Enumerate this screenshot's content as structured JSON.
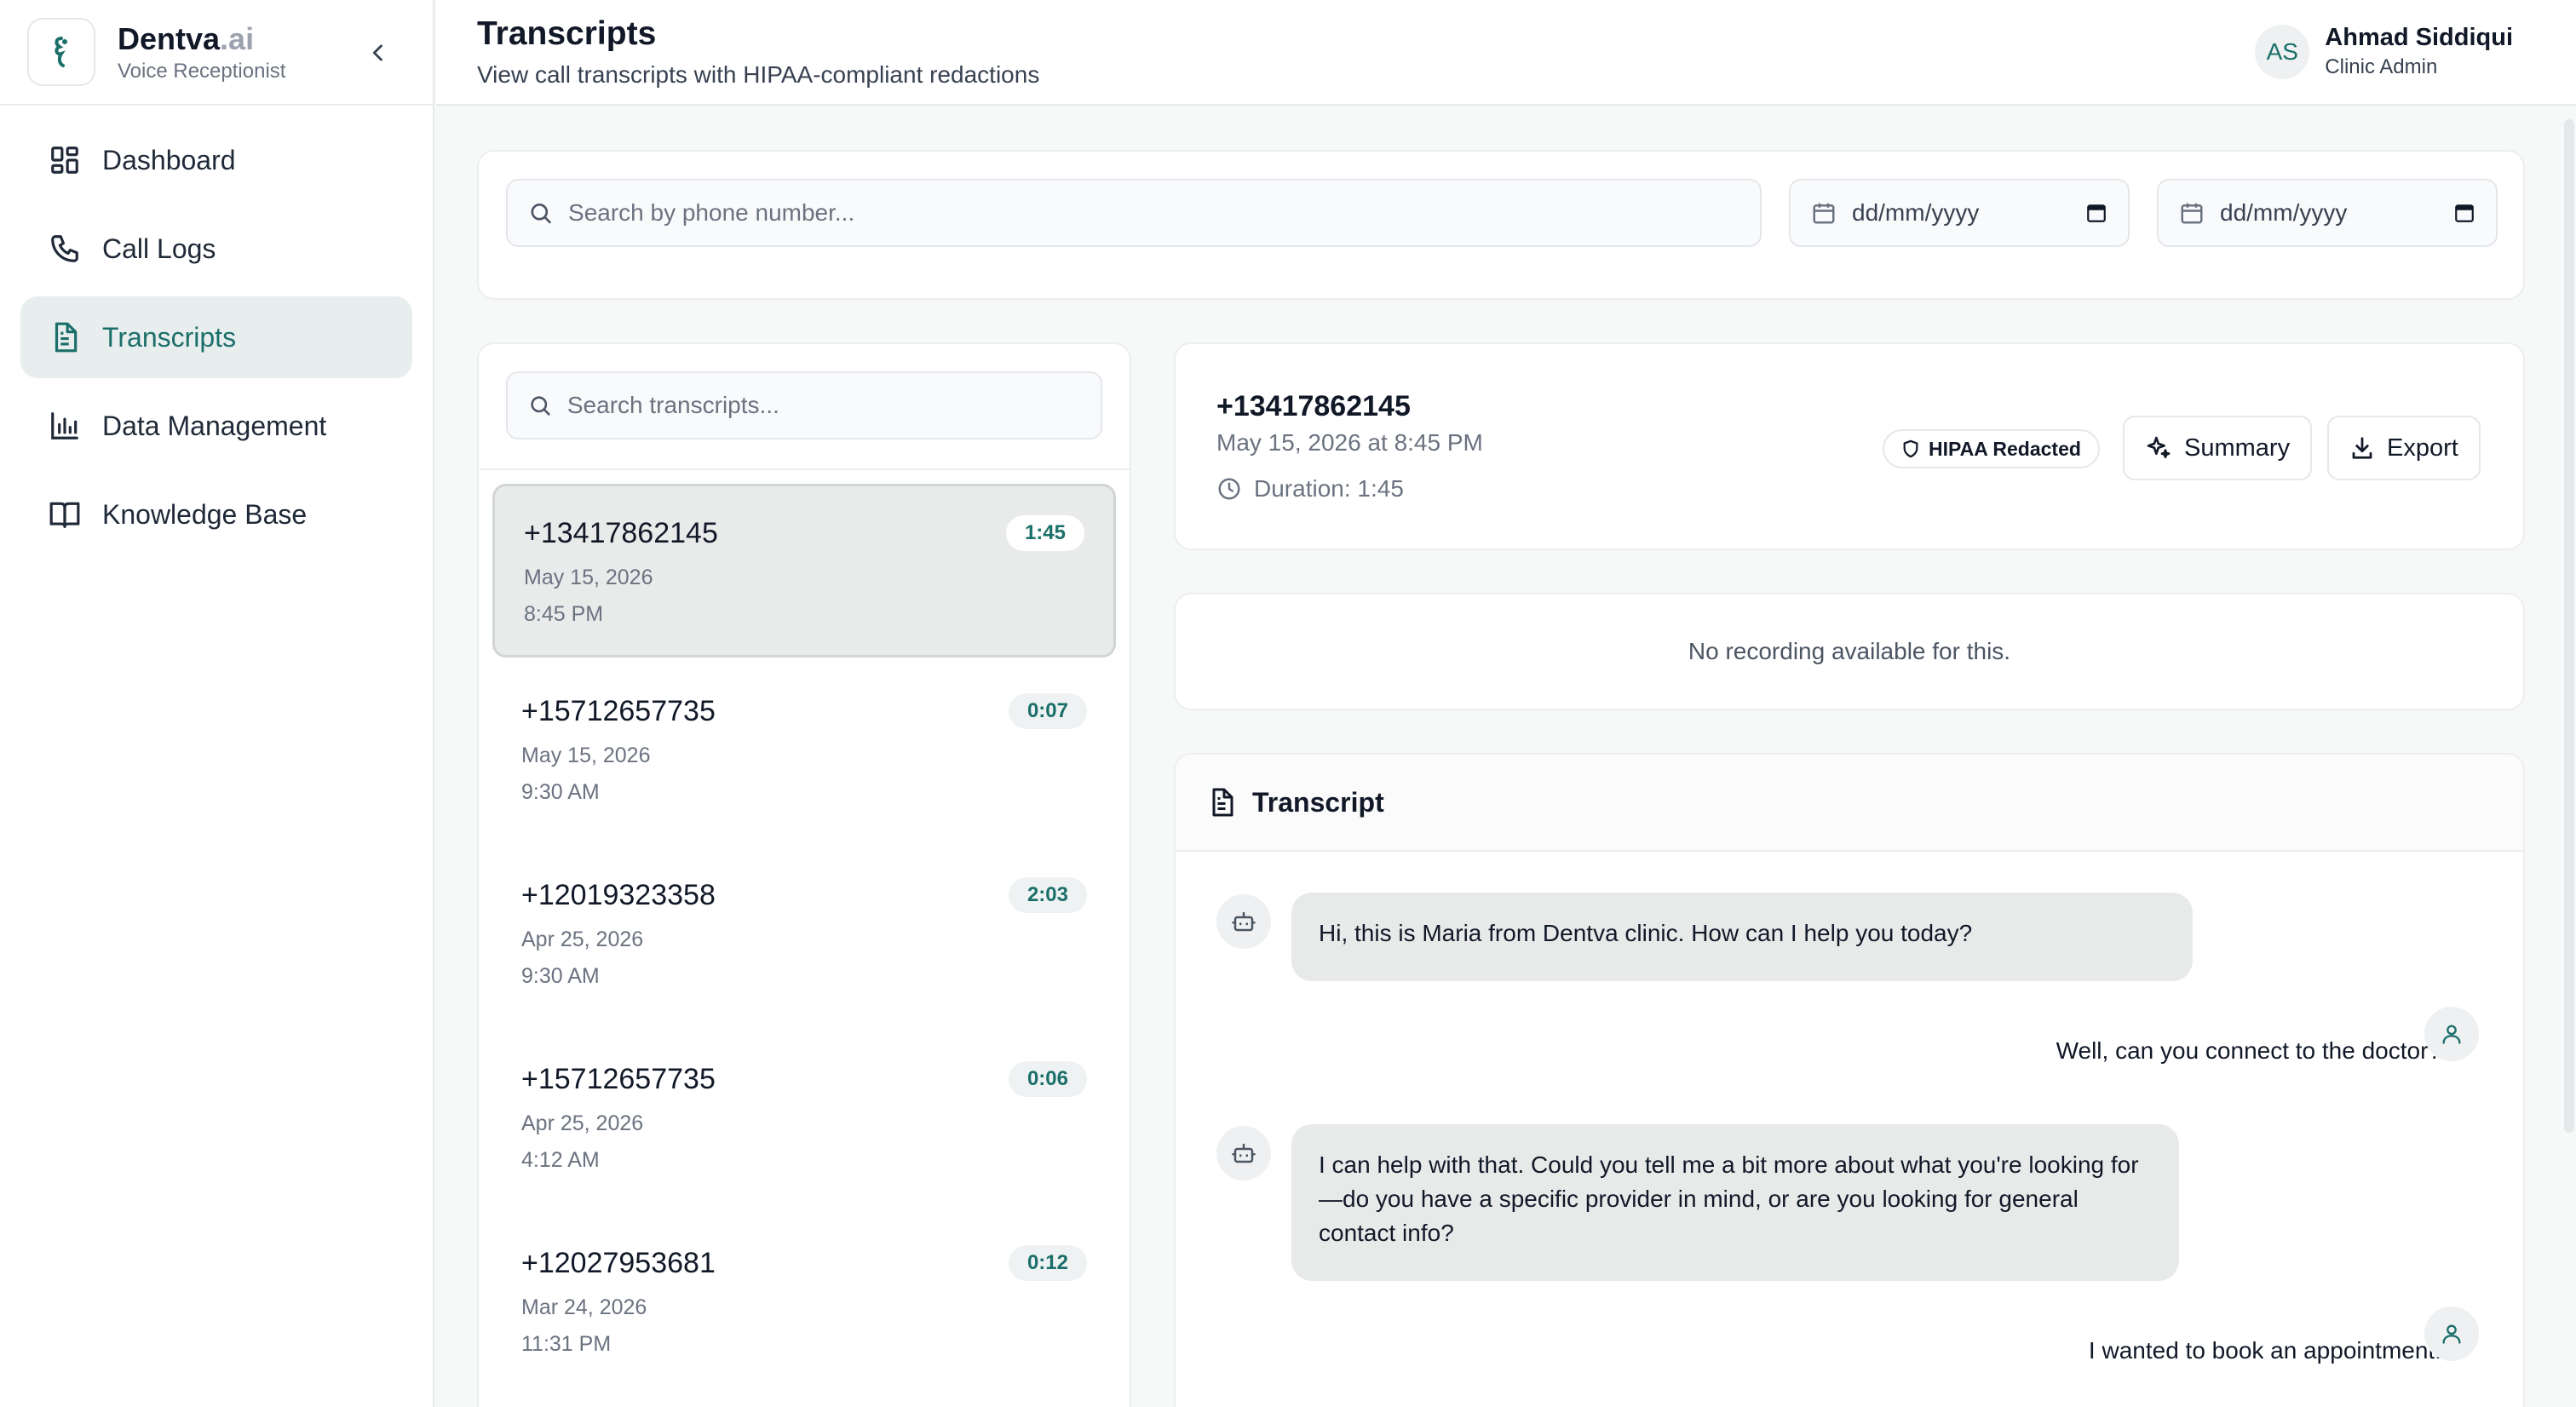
{
  "brand": {
    "name": "Dentva",
    "suffix": ".ai",
    "subtitle": "Voice Receptionist"
  },
  "nav": [
    {
      "label": "Dashboard",
      "icon": "dashboard-icon",
      "active": false
    },
    {
      "label": "Call Logs",
      "icon": "phone-icon",
      "active": false
    },
    {
      "label": "Transcripts",
      "icon": "document-icon",
      "active": true
    },
    {
      "label": "Data Management",
      "icon": "bar-chart-icon",
      "active": false
    },
    {
      "label": "Knowledge Base",
      "icon": "book-icon",
      "active": false
    }
  ],
  "header": {
    "title": "Transcripts",
    "subtitle": "View call transcripts with HIPAA-compliant redactions"
  },
  "user": {
    "initials": "AS",
    "name": "Ahmad Siddiqui",
    "role": "Clinic Admin"
  },
  "filters": {
    "phone_placeholder": "Search by phone number...",
    "date_from": "dd/mm/yyyy",
    "date_to": "dd/mm/yyyy"
  },
  "list": {
    "search_placeholder": "Search transcripts...",
    "items": [
      {
        "phone": "+13417862145",
        "date": "May 15, 2026",
        "time": "8:45 PM",
        "duration": "1:45",
        "selected": true
      },
      {
        "phone": "+15712657735",
        "date": "May 15, 2026",
        "time": "9:30 AM",
        "duration": "0:07"
      },
      {
        "phone": "+12019323358",
        "date": "Apr 25, 2026",
        "time": "9:30 AM",
        "duration": "2:03"
      },
      {
        "phone": "+15712657735",
        "date": "Apr 25, 2026",
        "time": "4:12 AM",
        "duration": "0:06"
      },
      {
        "phone": "+12027953681",
        "date": "Mar 24, 2026",
        "time": "11:31 PM",
        "duration": "0:12"
      }
    ]
  },
  "detail": {
    "phone": "+13417862145",
    "datetime": "May 15, 2026 at 8:45 PM",
    "duration": "Duration: 1:45",
    "badge": "HIPAA Redacted",
    "summary_label": "Summary",
    "export_label": "Export"
  },
  "recording": {
    "empty_text": "No recording available for this."
  },
  "transcript": {
    "title": "Transcript",
    "messages": [
      {
        "role": "agent",
        "text": "Hi, this is Maria from Dentva clinic. How can I help you today?"
      },
      {
        "role": "user",
        "text": "Well, can you connect to the doctor?"
      },
      {
        "role": "agent",
        "text": "I can help with that. Could you tell me a bit more about what you're looking for—do you have a specific provider in mind, or are you looking for general contact info?"
      },
      {
        "role": "user",
        "text": "I wanted to book an appointment."
      }
    ]
  },
  "colors": {
    "accent": "#1b6f6a",
    "active_bg": "#e8eeee",
    "bubble_bg": "#e8eaea"
  }
}
